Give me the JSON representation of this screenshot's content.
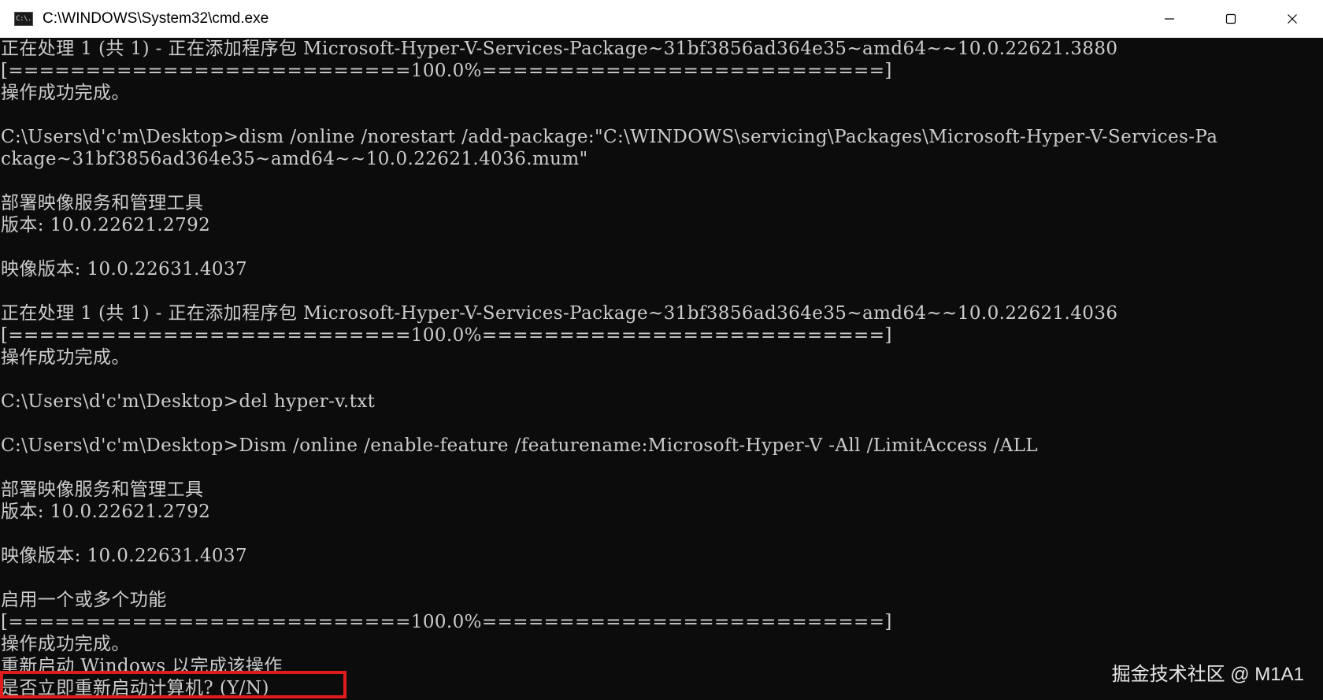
{
  "window": {
    "icon_label": "C:\\.",
    "title": "C:\\WINDOWS\\System32\\cmd.exe"
  },
  "controls": {
    "minimize": "minimize-icon",
    "maximize": "maximize-icon",
    "close": "close-icon"
  },
  "console": {
    "lines": [
      "正在处理 1 (共 1) - 正在添加程序包 Microsoft-Hyper-V-Services-Package~31bf3856ad364e35~amd64~~10.0.22621.3880",
      "[==========================100.0%==========================]",
      "操作成功完成。",
      "",
      "C:\\Users\\d'c'm\\Desktop>dism /online /norestart /add-package:\"C:\\WINDOWS\\servicing\\Packages\\Microsoft-Hyper-V-Services-Pa",
      "ckage~31bf3856ad364e35~amd64~~10.0.22621.4036.mum\"",
      "",
      "部署映像服务和管理工具",
      "版本: 10.0.22621.2792",
      "",
      "映像版本: 10.0.22631.4037",
      "",
      "正在处理 1 (共 1) - 正在添加程序包 Microsoft-Hyper-V-Services-Package~31bf3856ad364e35~amd64~~10.0.22621.4036",
      "[==========================100.0%==========================]",
      "操作成功完成。",
      "",
      "C:\\Users\\d'c'm\\Desktop>del hyper-v.txt",
      "",
      "C:\\Users\\d'c'm\\Desktop>Dism /online /enable-feature /featurename:Microsoft-Hyper-V -All /LimitAccess /ALL",
      "",
      "部署映像服务和管理工具",
      "版本: 10.0.22621.2792",
      "",
      "映像版本: 10.0.22631.4037",
      "",
      "启用一个或多个功能",
      "[==========================100.0%==========================]",
      "操作成功完成。",
      "重新启动 Windows 以完成该操作",
      "是否立即重新启动计算机? (Y/N)"
    ]
  },
  "watermark": {
    "text": "掘金技术社区 @ M1A1"
  },
  "colors": {
    "console_bg": "#0c0c0c",
    "console_fg": "#cccccc",
    "highlight": "#e11b1b",
    "titlebar_bg": "#ffffff"
  }
}
